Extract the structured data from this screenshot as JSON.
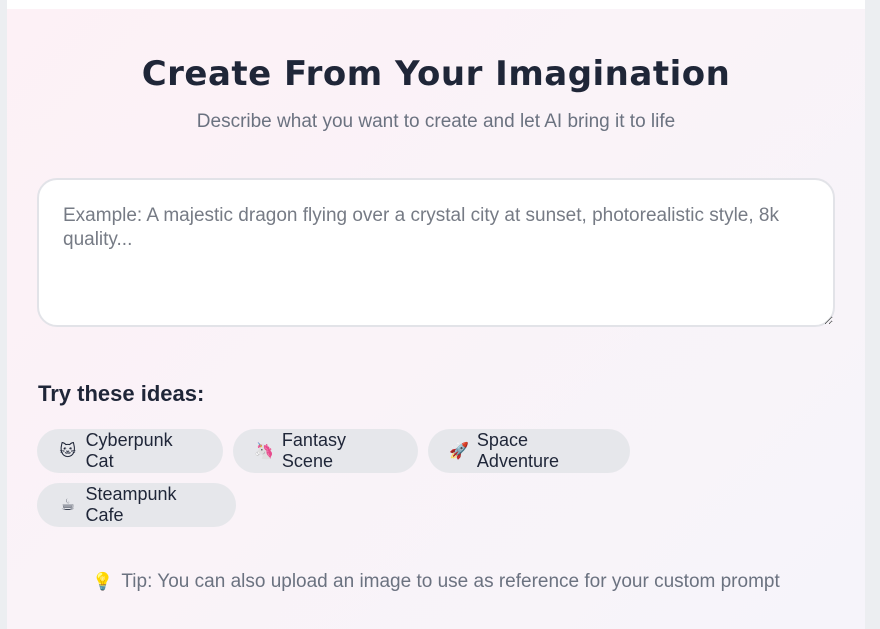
{
  "header": {
    "title": "Create From Your Imagination",
    "subtitle": "Describe what you want to create and let AI bring it to life"
  },
  "prompt": {
    "value": "",
    "placeholder": "Example: A majestic dragon flying over a crystal city at sunset, photorealistic style, 8k quality..."
  },
  "ideas": {
    "heading": "Try these ideas:",
    "items": [
      {
        "emoji": "🐱",
        "label": "Cyberpunk Cat",
        "icon": "cat-face-icon"
      },
      {
        "emoji": "🦄",
        "label": "Fantasy Scene",
        "icon": "unicorn-icon"
      },
      {
        "emoji": "🚀",
        "label": "Space Adventure",
        "icon": "rocket-icon"
      },
      {
        "emoji": "☕",
        "label": "Steampunk Cafe",
        "icon": "coffee-icon"
      }
    ]
  },
  "tip": {
    "emoji": "💡",
    "icon": "lightbulb-icon",
    "text": "Tip: You can also upload an image to use as reference for your custom prompt"
  },
  "colors": {
    "heading": "#1f2638",
    "muted": "#6b7280",
    "chip_bg": "#e6e7eb",
    "panel_bg": "#fbf2f7"
  }
}
